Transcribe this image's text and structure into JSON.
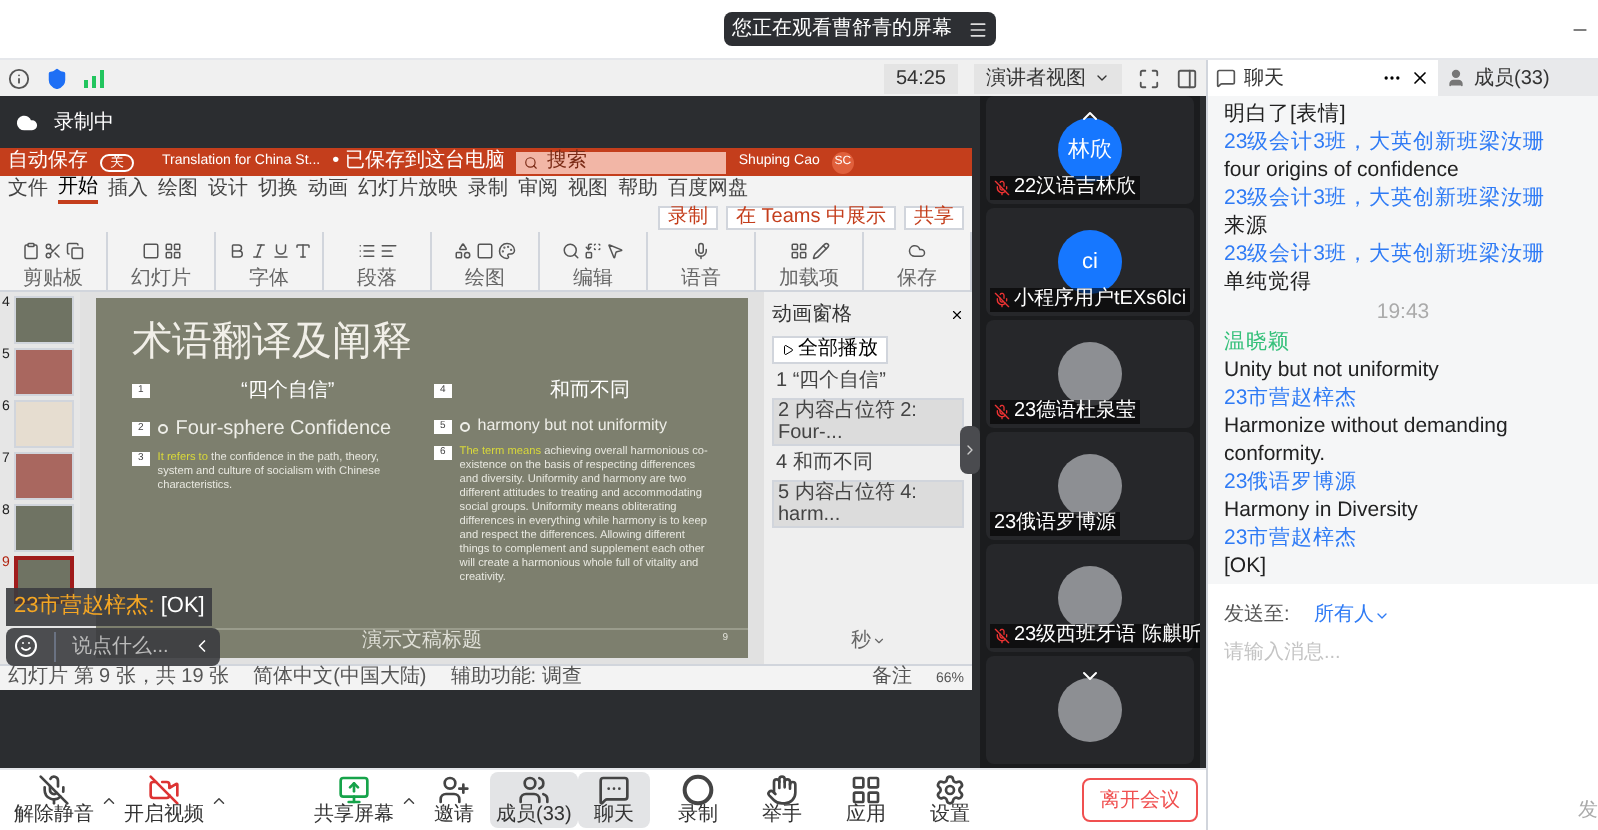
{
  "screen_banner": {
    "text": "您正在观看曹舒青的屏幕"
  },
  "toolbar": {
    "timer": "54:25",
    "view_button": "演讲者视图"
  },
  "recording": {
    "label": "录制中"
  },
  "ppt": {
    "title_bar": {
      "autosave": "自动保存",
      "autosave_toggle": "关",
      "file": "Translation for China St...",
      "saved": "• 已保存到这台电脑",
      "search_placeholder": "搜索",
      "user": "Shuping Cao",
      "initials": "SC"
    },
    "tabs": [
      {
        "label": "文件",
        "selected": false
      },
      {
        "label": "开始",
        "selected": true
      },
      {
        "label": "插入",
        "selected": false
      },
      {
        "label": "绘图",
        "selected": false
      },
      {
        "label": "设计",
        "selected": false
      },
      {
        "label": "切换",
        "selected": false
      },
      {
        "label": "动画",
        "selected": false
      },
      {
        "label": "幻灯片放映",
        "selected": false
      },
      {
        "label": "录制",
        "selected": false
      },
      {
        "label": "审阅",
        "selected": false
      },
      {
        "label": "视图",
        "selected": false
      },
      {
        "label": "帮助",
        "selected": false
      },
      {
        "label": "百度网盘",
        "selected": false
      }
    ],
    "actions": [
      "录制",
      "在 Teams 中展示",
      "共享"
    ],
    "groups": [
      "剪贴板",
      "幻灯片",
      "字体",
      "段落",
      "绘图",
      "编辑",
      "语音",
      "加载项",
      "保存"
    ],
    "thumbnails": [
      {
        "number": "4",
        "color": "#6f7363",
        "selected": false
      },
      {
        "number": "5",
        "color": "#a9675f",
        "selected": false
      },
      {
        "number": "6",
        "color": "#e6ddd0",
        "selected": false
      },
      {
        "number": "7",
        "color": "#a9675f",
        "selected": false
      },
      {
        "number": "8",
        "color": "#6f7363",
        "selected": false
      },
      {
        "number": "9",
        "color": "#6f7363",
        "selected": true
      }
    ],
    "slide": {
      "title": "术语翻译及阐释",
      "footer": "演示文稿标题",
      "page": "9",
      "columns": [
        {
          "items": [
            {
              "kind": "heading",
              "badge": "1",
              "text": "“四个自信”"
            },
            {
              "kind": "bullet",
              "badge": "2",
              "text": "Four-sphere Confidence"
            },
            {
              "kind": "paragraph",
              "badge": "3",
              "lead": "It refers to",
              "text": "the confidence in the path, theory, system and culture of socialism with Chinese characteristics."
            }
          ]
        },
        {
          "items": [
            {
              "kind": "heading",
              "badge": "4",
              "text": "和而不同"
            },
            {
              "kind": "bullet",
              "badge": "5",
              "text": "harmony but not uniformity"
            },
            {
              "kind": "paragraph",
              "badge": "6",
              "lead": "The term means",
              "text": "achieving overall harmonious co-existence on the basis of respecting differences and diversity. Uniformity and harmony are two different attitudes to treating and accommodating social groups. Uniformity means obliterating differences in everything while harmony is to keep and respect the differences. Allowing different things to complement and supplement each other will create a harmonious whole full of vitality and creativity."
            }
          ]
        }
      ]
    },
    "animation_pane": {
      "title": "动画窗格",
      "play_all": "全部播放",
      "unit": "秒",
      "items": [
        {
          "label": "1 “四个自信”",
          "selected": false
        },
        {
          "label": "2 内容占位符 2: Four-...",
          "selected": true
        },
        {
          "label": "4 和而不同",
          "selected": false
        },
        {
          "label": "5 内容占位符 4: harm...",
          "selected": true
        }
      ]
    },
    "status_bar": {
      "slide_count": "幻灯片 第 9 张，共 19 张",
      "language": "简体中文(中国大陆)",
      "accessibility": "辅助功能: 调查",
      "notes": "备注",
      "zoom": "66%"
    }
  },
  "overlay": {
    "sender": "23市营赵梓杰:",
    "text": "[OK]",
    "input_placeholder": "说点什么..."
  },
  "participants": [
    {
      "name": "22汉语吉林欣",
      "kind": "initials",
      "avatar_text": "林欣",
      "muted": true,
      "scroll_up": true,
      "scroll_down": false
    },
    {
      "name": "小程序用户tEXs6lci",
      "kind": "initials",
      "avatar_text": "ci",
      "muted": true,
      "scroll_up": false,
      "scroll_down": false
    },
    {
      "name": "23德语杜泉莹",
      "kind": "photo",
      "muted": true,
      "scroll_up": false,
      "scroll_down": false
    },
    {
      "name": "23俄语罗博源",
      "kind": "photo",
      "muted": false,
      "scroll_up": false,
      "scroll_down": false
    },
    {
      "name": "23级西班牙语 陈麒昕",
      "kind": "photo",
      "muted": true,
      "scroll_up": false,
      "scroll_down": false
    },
    {
      "kind": "photo",
      "scroll_up": false,
      "scroll_down": true
    }
  ],
  "chat": {
    "tabs": [
      {
        "label": "聊天",
        "selected": true
      },
      {
        "label": "成员(33)",
        "selected": false
      }
    ],
    "messages": [
      {
        "kind": "message",
        "text": "明白了[表情]"
      },
      {
        "kind": "message",
        "sender": "23级会计3班，大英创新班梁汝珊",
        "color": "#2f7bf5",
        "text": "four origins of  confidence"
      },
      {
        "kind": "message",
        "sender": "23级会计3班，大英创新班梁汝珊",
        "color": "#2f7bf5",
        "text": "来源"
      },
      {
        "kind": "message",
        "sender": "23级会计3班，大英创新班梁汝珊",
        "color": "#2f7bf5",
        "text": "单纯觉得"
      },
      {
        "kind": "time",
        "text": "19:43"
      },
      {
        "kind": "message",
        "sender": "温晓颖",
        "color": "#35c07a",
        "text": "Unity but not uniformity"
      },
      {
        "kind": "message",
        "sender": "23市营赵梓杰",
        "color": "#2f7bf5",
        "text": "Harmonize without demanding conformity."
      },
      {
        "kind": "message",
        "sender": "23俄语罗博源",
        "color": "#2f7bf5",
        "text": "Harmony in Diversity"
      },
      {
        "kind": "message",
        "sender": "23市营赵梓杰",
        "color": "#2f7bf5",
        "text": "[OK]"
      }
    ],
    "send_to_label": "发送至:",
    "send_to": "所有人",
    "input_placeholder": "请输入消息...",
    "edge_text": "发"
  },
  "bottom_bar": {
    "buttons": [
      {
        "kind": "mic",
        "label": "解除静音",
        "selected": false,
        "has_menu": true
      },
      {
        "kind": "video",
        "label": "开启视频",
        "selected": false,
        "has_menu": true
      },
      {
        "kind": "share",
        "label": "共享屏幕",
        "selected": false,
        "has_menu": true
      },
      {
        "kind": "invite",
        "label": "邀请",
        "selected": false,
        "has_menu": false
      },
      {
        "kind": "members",
        "label": "成员(33)",
        "selected": true,
        "has_menu": false
      },
      {
        "kind": "chat",
        "label": "聊天",
        "selected": true,
        "has_menu": false
      },
      {
        "kind": "record",
        "label": "录制",
        "selected": false,
        "has_menu": false
      },
      {
        "kind": "hand",
        "label": "举手",
        "selected": false,
        "has_menu": false
      },
      {
        "kind": "apps",
        "label": "应用",
        "selected": false,
        "has_menu": false
      },
      {
        "kind": "settings",
        "label": "设置",
        "selected": false,
        "has_menu": false
      }
    ],
    "leave": "离开会议"
  }
}
